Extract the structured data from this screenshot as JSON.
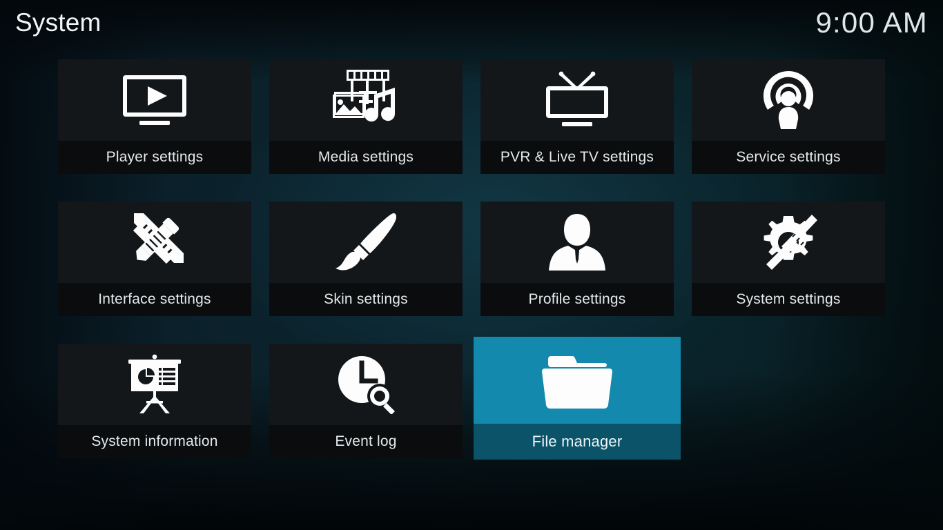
{
  "header": {
    "title": "System",
    "clock": "9:00 AM"
  },
  "theme": {
    "accent": "#1489ae",
    "accent_dark": "#0b5368",
    "tile_bg": "#13171a",
    "tile_label_bg": "#0a0c0e",
    "text": "#e4eaec",
    "icon": "#fdfdfd"
  },
  "grid": {
    "columns": 4,
    "rows": 3,
    "tiles": [
      {
        "label": "Player settings",
        "icon": "monitor-play-icon",
        "selected": false
      },
      {
        "label": "Media settings",
        "icon": "filmstrip-photo-music-icon",
        "selected": false
      },
      {
        "label": "PVR & Live TV settings",
        "icon": "tv-antenna-icon",
        "selected": false
      },
      {
        "label": "Service settings",
        "icon": "broadcast-person-icon",
        "selected": false
      },
      {
        "label": "Interface settings",
        "icon": "pencil-ruler-icon",
        "selected": false
      },
      {
        "label": "Skin settings",
        "icon": "paintbrush-icon",
        "selected": false
      },
      {
        "label": "Profile settings",
        "icon": "person-icon",
        "selected": false
      },
      {
        "label": "System settings",
        "icon": "gear-tools-icon",
        "selected": false
      },
      {
        "label": "System information",
        "icon": "presentation-chart-icon",
        "selected": false
      },
      {
        "label": "Event log",
        "icon": "clock-search-icon",
        "selected": false
      },
      {
        "label": "File manager",
        "icon": "folder-icon",
        "selected": true
      }
    ]
  }
}
